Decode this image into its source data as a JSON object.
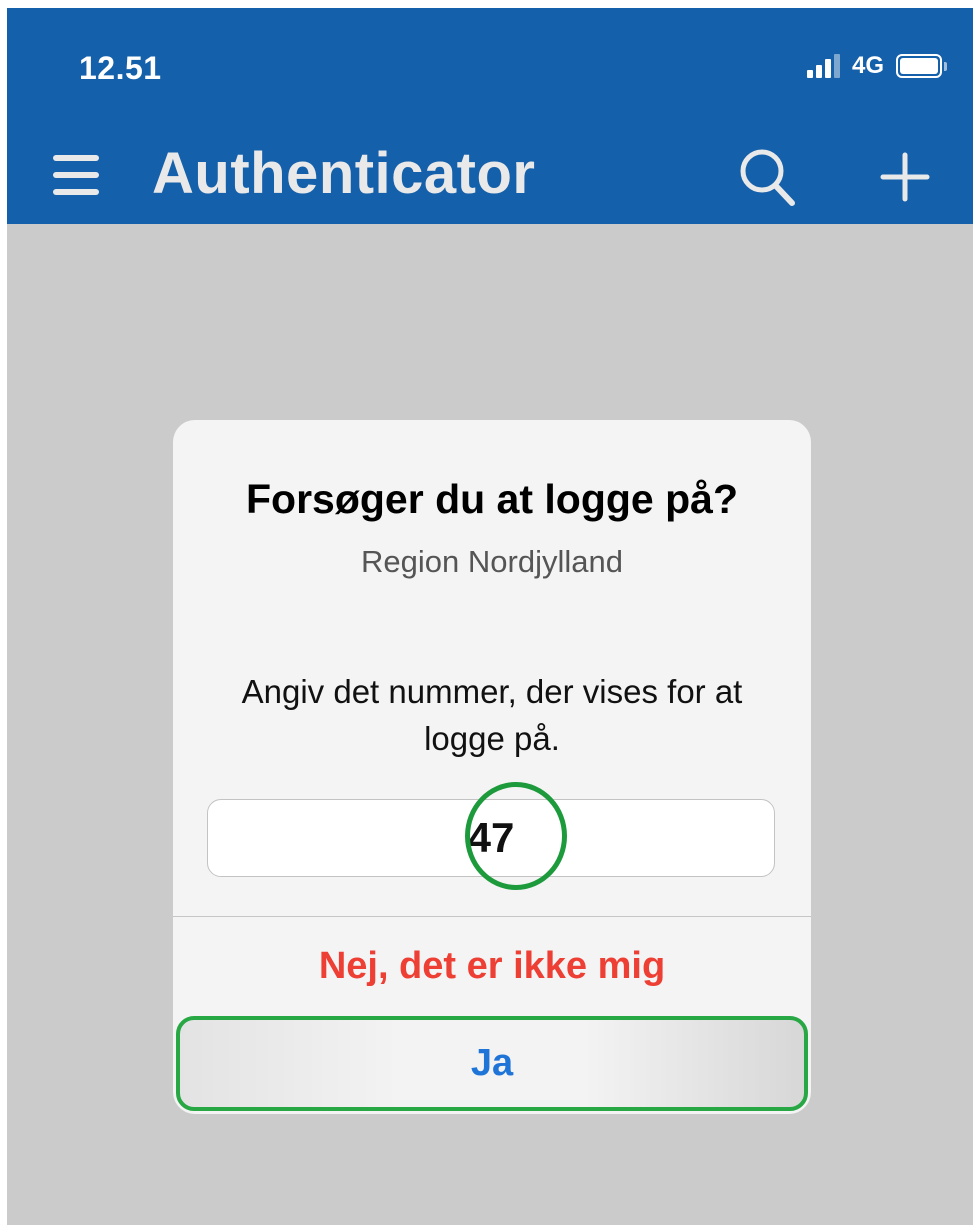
{
  "status_bar": {
    "time": "12.51",
    "network": "4G",
    "icons": [
      "signal-icon",
      "battery-icon"
    ]
  },
  "app_bar": {
    "title": "Authenticator",
    "icons": [
      "menu-icon",
      "search-icon",
      "plus-icon"
    ]
  },
  "dialog": {
    "title": "Forsøger du at logge på?",
    "subtitle": "Region Nordjylland",
    "message": "Angiv det nummer, der vises for at logge på.",
    "number": "47",
    "reject_label": "Nej, det er ikke mig",
    "approve_label": "Ja"
  },
  "colors": {
    "header": "#1560aa",
    "background": "#cbcbcb",
    "dialog": "#f4f4f4",
    "reject": "#ee3f34",
    "approve": "#1f74d8",
    "highlight": "#28a745"
  }
}
